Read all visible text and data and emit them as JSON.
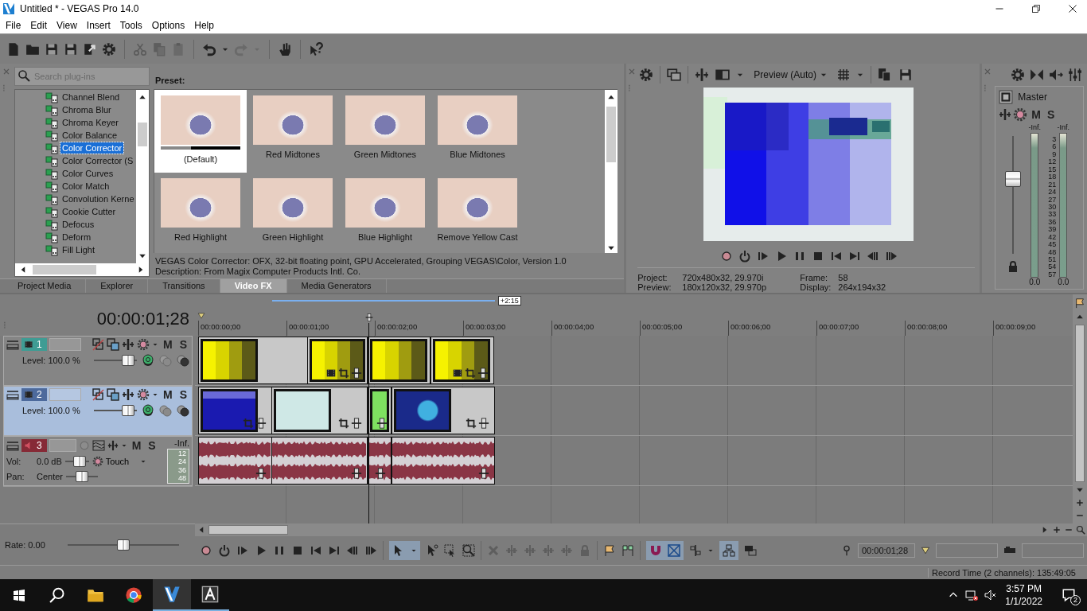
{
  "window": {
    "title": "Untitled * - VEGAS Pro 14.0"
  },
  "menu": [
    "File",
    "Edit",
    "View",
    "Insert",
    "Tools",
    "Options",
    "Help"
  ],
  "plugins": {
    "search": {
      "placeholder": "Search plug-ins"
    },
    "tree": [
      {
        "label": "Channel Blend",
        "selected": false
      },
      {
        "label": "Chroma Blur",
        "selected": false
      },
      {
        "label": "Chroma Keyer",
        "selected": false
      },
      {
        "label": "Color Balance",
        "selected": false
      },
      {
        "label": "Color Corrector",
        "selected": true
      },
      {
        "label": "Color Corrector (S",
        "selected": false
      },
      {
        "label": "Color Curves",
        "selected": false
      },
      {
        "label": "Color Match",
        "selected": false
      },
      {
        "label": "Convolution Kerne",
        "selected": false
      },
      {
        "label": "Cookie Cutter",
        "selected": false
      },
      {
        "label": "Defocus",
        "selected": false
      },
      {
        "label": "Deform",
        "selected": false
      },
      {
        "label": "Fill Light",
        "selected": false
      }
    ],
    "preset_heading": "Preset:",
    "presets": [
      {
        "label": "(Default)",
        "selected": true
      },
      {
        "label": "Red Midtones",
        "selected": false
      },
      {
        "label": "Green Midtones",
        "selected": false
      },
      {
        "label": "Blue Midtones",
        "selected": false
      },
      {
        "label": "Red Highlight",
        "selected": false
      },
      {
        "label": "Green Highlight",
        "selected": false
      },
      {
        "label": "Blue Highlight",
        "selected": false
      },
      {
        "label": "Remove Yellow Cast",
        "selected": false
      }
    ],
    "info": [
      "VEGAS Color Corrector: OFX, 32-bit floating point, GPU Accelerated, Grouping VEGAS\\Color, Version 1.0",
      "Description: From Magix Computer Products Intl. Co."
    ],
    "tabs": [
      {
        "label": "Project Media",
        "selected": false
      },
      {
        "label": "Explorer",
        "selected": false
      },
      {
        "label": "Transitions",
        "selected": false
      },
      {
        "label": "Video FX",
        "selected": true
      },
      {
        "label": "Media Generators",
        "selected": false
      }
    ]
  },
  "preview": {
    "mode": "Preview (Auto)",
    "info": [
      {
        "label": "Project:",
        "value": "720x480x32, 29.970i"
      },
      {
        "label": "Frame:",
        "value": "58"
      },
      {
        "label": "Preview:",
        "value": "180x120x32, 29.970p"
      },
      {
        "label": "Display:",
        "value": "264x194x32"
      }
    ]
  },
  "master": {
    "title": "Master",
    "mute": "M",
    "solo": "S",
    "fader": {
      "level": 0.66
    },
    "meters": [
      {
        "peak": "-Inf.",
        "reading": "0.0"
      },
      {
        "peak": "-Inf.",
        "reading": "0.0"
      }
    ],
    "scale": [
      "3",
      "6",
      "9",
      "12",
      "15",
      "18",
      "21",
      "24",
      "27",
      "30",
      "33",
      "36",
      "39",
      "42",
      "45",
      "48",
      "51",
      "54",
      "57"
    ]
  },
  "timeline": {
    "time": "00:00:01;28",
    "loop_label": "+2:15",
    "ruler": [
      "00:00:00;00",
      "00:00:01;00",
      "00:00:02;00",
      "00:00:03;00",
      "00:00:04;00",
      "00:00:05;00",
      "00:00:06;00",
      "00:00:07;00",
      "00:00:08;00",
      "00:00:09;00"
    ],
    "tracks": [
      {
        "kind": "video",
        "number": "1",
        "color": "#3f9c94",
        "selected": false,
        "mute": "M",
        "solo": "S",
        "level_text": "Level: 100.0 %",
        "fader": {
          "level": 0.92
        }
      },
      {
        "kind": "video",
        "number": "2",
        "color": "#4d6a9c",
        "selected": true,
        "mute": "M",
        "solo": "S",
        "level_text": "Level: 100.0 %",
        "fader": {
          "level": 0.92
        }
      },
      {
        "kind": "audio",
        "number": "3",
        "color": "#862a36",
        "selected": false,
        "mute": "M",
        "solo": "S",
        "peak": "-Inf.",
        "vol_label": "Vol:",
        "vol": "0.0 dB",
        "vol_fader": {
          "level": 0.72
        },
        "automation": "Touch",
        "pan_label": "Pan:",
        "pan": "Center",
        "pan_fader": {
          "level": 0.5
        },
        "meter_scale": [
          "12",
          "24",
          "36",
          "48"
        ]
      }
    ],
    "rate": "Rate: 0.00",
    "rate_slider": {
      "level": 0.5
    },
    "cursor_time": "00:00:01;28"
  },
  "status_bar": "Record Time (2 channels): 135:49:05",
  "taskbar": {
    "time": "3:57 PM",
    "date": "1/1/2022",
    "notifications": "2"
  }
}
